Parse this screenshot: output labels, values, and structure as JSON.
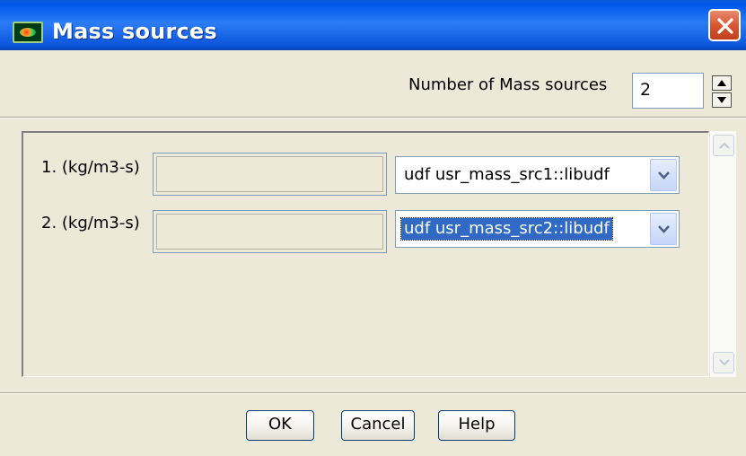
{
  "window": {
    "title": "Mass sources",
    "close_icon": "close-icon",
    "app_icon": "fluent-app-icon"
  },
  "header": {
    "number_label": "Number of Mass sources",
    "number_value": "2"
  },
  "rows": [
    {
      "label": "1. (kg/m3-s)",
      "value": "",
      "selection": "udf usr_mass_src1::libudf"
    },
    {
      "label": "2. (kg/m3-s)",
      "value": "",
      "selection": "udf usr_mass_src2::libudf"
    }
  ],
  "buttons": {
    "ok": "OK",
    "cancel": "Cancel",
    "help": "Help"
  },
  "colors": {
    "titlebar": "#0058ee",
    "dialog_bg": "#ece9d8",
    "selection": "#316ac5",
    "close": "#d85832"
  }
}
